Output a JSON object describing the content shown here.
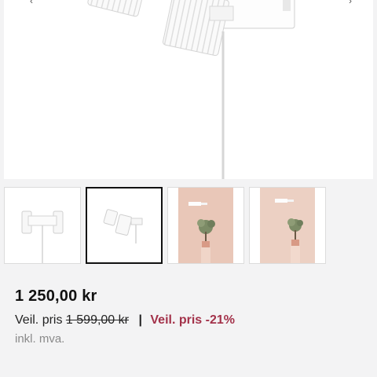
{
  "gallery": {
    "main_image_alt": "Vegglampe med to spotter, hvit",
    "selected_index": 1,
    "thumbnails": [
      {
        "alt": "Vegglampe front"
      },
      {
        "alt": "Vegglampe to spotter"
      },
      {
        "alt": "Vegglampe miljøbilde"
      },
      {
        "alt": "Vegglampe miljøbilde 2"
      }
    ]
  },
  "product": {
    "price": "1 250,00 kr",
    "veil_label": "Veil. pris",
    "veil_price": "1 599,00 kr",
    "separator": "|",
    "discount": "Veil. pris -21%",
    "vat_note": "inkl. mva."
  },
  "colors": {
    "background": "#f3f3f4",
    "discount": "#a3324a",
    "selected_border": "#111111",
    "wall": "#e9c7b8"
  }
}
